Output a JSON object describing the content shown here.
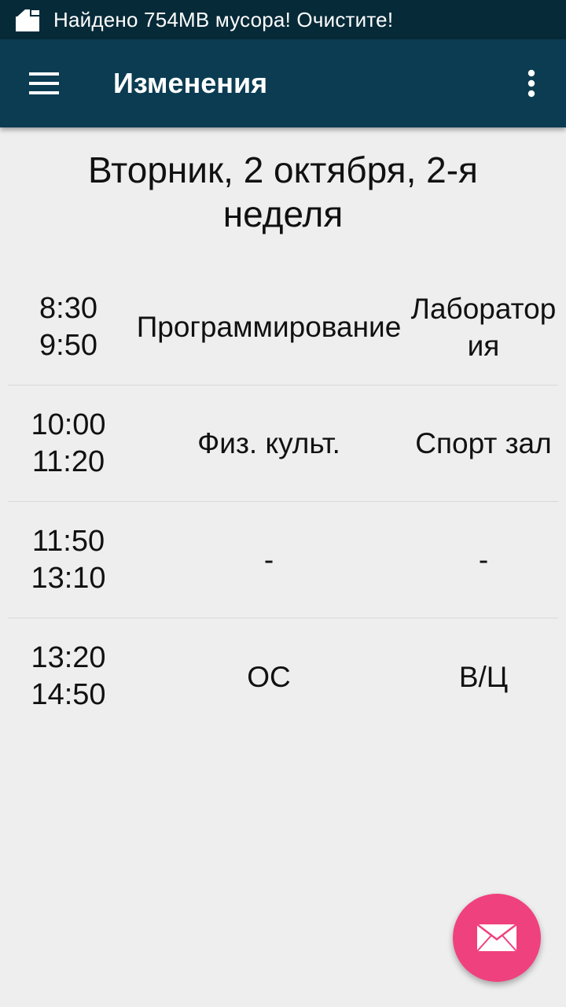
{
  "status_bar": {
    "notification_icon": "cleaner-icon",
    "notification_text": "Найдено 754MB мусора! Очистите!"
  },
  "app_bar": {
    "menu_icon": "hamburger-menu-icon",
    "title": "Изменения",
    "overflow_icon": "more-vert-icon",
    "color": "#0b3c52"
  },
  "day_header": "Вторник, 2 октября, 2-я неделя",
  "schedule": [
    {
      "start": "8:30",
      "end": "9:50",
      "subject": "Программирование",
      "room": "Лаборатория"
    },
    {
      "start": "10:00",
      "end": "11:20",
      "subject": "Физ. культ.",
      "room": "Спорт зал"
    },
    {
      "start": "11:50",
      "end": "13:10",
      "subject": "-",
      "room": "-"
    },
    {
      "start": "13:20",
      "end": "14:50",
      "subject": "ОС",
      "room": "В/Ц"
    }
  ],
  "fab": {
    "icon": "mail-icon",
    "color": "#f0417f"
  }
}
